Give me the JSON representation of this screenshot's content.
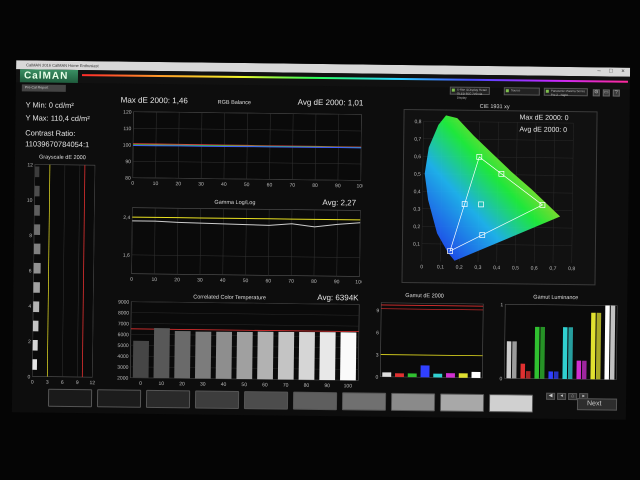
{
  "window": {
    "title": "CalMAN 2016 CalMAN Home Enthusiast",
    "controls": [
      "–",
      "□",
      "×"
    ]
  },
  "app": {
    "logo": "CalMAN",
    "tab": "Pre-Cal Report",
    "dropdowns": [
      {
        "line1": "X-Rite i1Display Retail",
        "line2": "OLED 65C 7V0 via Display"
      },
      {
        "line1": "Source",
        "line2": ""
      },
      {
        "line1": "Panasonic Plasma Series",
        "line2": "Pre 2 - Night"
      }
    ],
    "icons": [
      "settings-icon",
      "window-icon",
      "help-icon"
    ]
  },
  "stats": {
    "ymin": "Y Min: 0 cd/m²",
    "ymax": "Y Max: 110,4 cd/m²",
    "contrast_label": "Contrast Ratio:",
    "contrast_value": "110396707840​54:1"
  },
  "rgb_balance": {
    "title": "RGB Balance",
    "max_de": "Max dE 2000: 1,46",
    "avg_de": "Avg dE 2000: 1,01"
  },
  "gamma": {
    "title": "Gamma Log/Log",
    "avg": "Avg: 2,27"
  },
  "cct": {
    "title": "Correlated Color Temperature",
    "avg": "Avg: 6394K"
  },
  "grayscale_de": {
    "title": "Grayscale dE 2000"
  },
  "cie": {
    "title": "CIE 1931 xy",
    "max_de": "Max dE 2000: 0",
    "avg_de": "Avg dE 2000: 0"
  },
  "gamut_de": {
    "title": "Gamut dE 2000"
  },
  "gamut_lum": {
    "title": "Gamut Luminance"
  },
  "bottom": {
    "next": "Next",
    "nav_icons": [
      "back-icon",
      "previous-icon",
      "home-icon",
      "forward-icon"
    ]
  },
  "chart_data": [
    {
      "type": "line",
      "title": "RGB Balance",
      "x": [
        0,
        10,
        20,
        30,
        40,
        50,
        60,
        70,
        80,
        90,
        100
      ],
      "ylim": [
        80,
        120
      ],
      "yticks": [
        80,
        90,
        100,
        110,
        120
      ],
      "xticks": [
        0,
        10,
        20,
        30,
        40,
        50,
        60,
        70,
        80,
        90,
        100
      ],
      "series": [
        {
          "color": "#e04040",
          "values": [
            100.6,
            100.6,
            100.5,
            100.5,
            100.4,
            100.4,
            100.3,
            100.3,
            100.3,
            100.2,
            100.2
          ]
        },
        {
          "color": "#40c040",
          "values": [
            100,
            100,
            100,
            100,
            100,
            100,
            100,
            100,
            100,
            100,
            100
          ]
        },
        {
          "color": "#4060ff",
          "values": [
            99.5,
            99.5,
            99.6,
            99.6,
            99.6,
            99.7,
            99.7,
            99.7,
            99.7,
            99.8,
            99.8
          ]
        }
      ]
    },
    {
      "type": "line",
      "title": "Gamma Log/Log",
      "x": [
        0,
        10,
        20,
        30,
        40,
        50,
        60,
        70,
        80,
        90,
        100
      ],
      "ylim": [
        1.2,
        2.6
      ],
      "yticks": [
        1.6,
        2.4
      ],
      "xticks": [
        0,
        10,
        20,
        30,
        40,
        50,
        60,
        70,
        80,
        90,
        100
      ],
      "series": [
        {
          "color": "#e8e020",
          "values": [
            2.4,
            2.4,
            2.4,
            2.4,
            2.4,
            2.4,
            2.4,
            2.4,
            2.4,
            2.4,
            2.4
          ]
        },
        {
          "color": "#cccccc",
          "values": [
            2.32,
            2.32,
            2.3,
            2.29,
            2.28,
            2.27,
            2.26,
            2.3,
            2.24,
            2.3,
            2.34
          ]
        }
      ]
    },
    {
      "type": "bar",
      "title": "Correlated Color Temperature",
      "categories": [
        "0",
        "10",
        "20",
        "30",
        "40",
        "50",
        "60",
        "70",
        "80",
        "90",
        "100"
      ],
      "values": [
        5400,
        6600,
        6350,
        6320,
        6330,
        6340,
        6380,
        6390,
        6400,
        6410,
        6420
      ],
      "ylim": [
        2000,
        9000
      ],
      "yticks": [
        2000,
        3000,
        4000,
        5000,
        6000,
        7000,
        8000,
        9000
      ],
      "reference": 6500
    },
    {
      "type": "bar",
      "title": "Grayscale dE 2000",
      "yticks": [
        0,
        2,
        4,
        6,
        8,
        10,
        12
      ],
      "xticks": [
        0,
        3,
        6,
        9,
        12
      ],
      "ylim": [
        0,
        12
      ],
      "values": [
        0.9,
        1.0,
        1.1,
        1.2,
        1.3,
        1.4,
        1.3,
        1.2,
        1.1,
        1.0,
        0.9
      ]
    },
    {
      "type": "scatter",
      "title": "CIE 1931 xy",
      "xlim": [
        0,
        0.8
      ],
      "ylim": [
        0,
        0.8
      ],
      "xticks": [
        0,
        0.1,
        0.2,
        0.3,
        0.4,
        0.5,
        0.6,
        0.7,
        0.8
      ],
      "yticks": [
        0.1,
        0.2,
        0.3,
        0.4,
        0.5,
        0.6,
        0.7,
        0.8
      ],
      "target_triangle": [
        [
          0.64,
          0.33
        ],
        [
          0.3,
          0.6
        ],
        [
          0.15,
          0.06
        ]
      ],
      "points": [
        [
          0.64,
          0.33
        ],
        [
          0.3,
          0.6
        ],
        [
          0.15,
          0.06
        ],
        [
          0.225,
          0.329
        ],
        [
          0.321,
          0.154
        ],
        [
          0.419,
          0.505
        ],
        [
          0.3127,
          0.329
        ]
      ]
    },
    {
      "type": "bar",
      "title": "Gamut dE 2000",
      "ylim": [
        0,
        10
      ],
      "yticks": [
        0,
        3,
        6,
        9
      ],
      "colors": [
        "#dddddd",
        "#e03030",
        "#30c030",
        "#3040ff",
        "#30d0d0",
        "#d030d0",
        "#e0e030",
        "#ffffff"
      ],
      "values": [
        0.6,
        0.5,
        0.5,
        1.6,
        0.5,
        0.6,
        0.6,
        0.8
      ]
    },
    {
      "type": "bar",
      "title": "Gamut Luminance",
      "ylim": [
        0,
        1
      ],
      "yticks": [
        0,
        1
      ],
      "groups": [
        {
          "color": "#cccccc",
          "values": [
            0.5,
            0.5
          ]
        },
        {
          "color": "#e03030",
          "values": [
            0.2,
            0.1
          ]
        },
        {
          "color": "#30c030",
          "values": [
            0.7,
            0.7
          ]
        },
        {
          "color": "#3040ff",
          "values": [
            0.1,
            0.1
          ]
        },
        {
          "color": "#30d0d0",
          "values": [
            0.7,
            0.7
          ]
        },
        {
          "color": "#d030d0",
          "values": [
            0.25,
            0.25
          ]
        },
        {
          "color": "#e0e030",
          "values": [
            0.9,
            0.9
          ]
        },
        {
          "color": "#ffffff",
          "values": [
            1.0,
            1.0
          ]
        }
      ]
    }
  ],
  "swatches": [
    "#1a1a1a",
    "#1c1c1c",
    "#2a2a2a",
    "#3d3d3d",
    "#4c4c4c",
    "#5e5e5e",
    "#707070",
    "#8a8a8a",
    "#a8a8a8",
    "#d0d0d0",
    "#f2f2f2"
  ]
}
